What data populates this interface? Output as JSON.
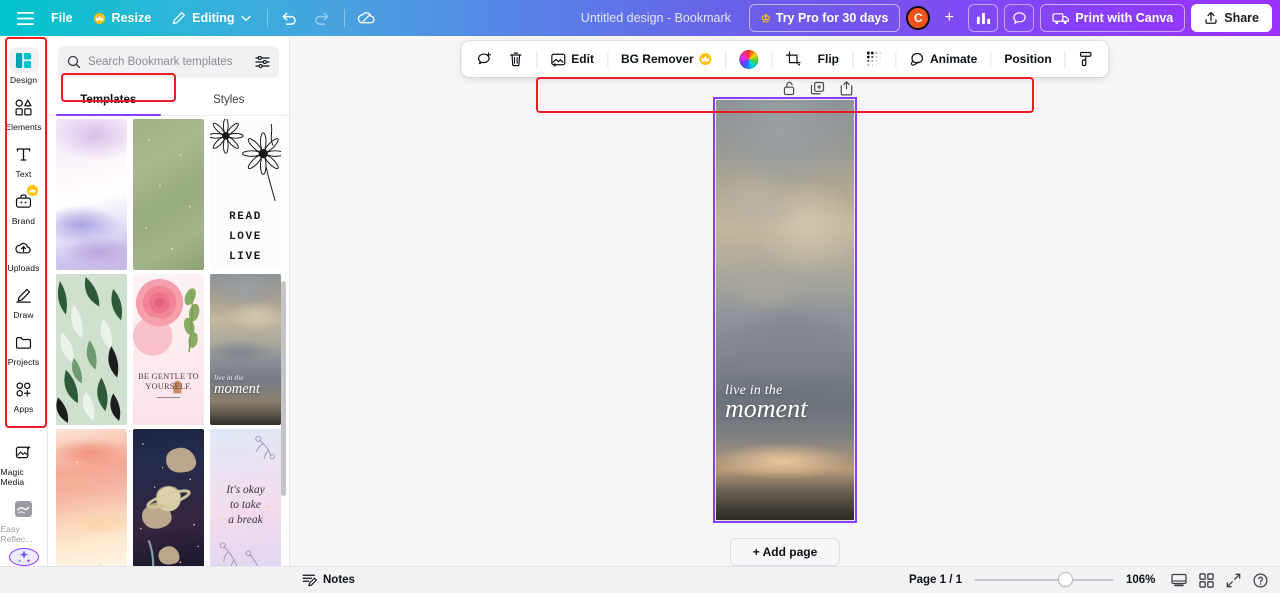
{
  "topbar": {
    "menu_icon": "hamburger-icon",
    "file_label": "File",
    "resize_label": "Resize",
    "editing_label": "Editing",
    "undo_icon": "undo-icon",
    "redo_icon": "redo-icon",
    "cloud_icon": "cloud-sync-icon",
    "doc_title": "Untitled design - Bookmark",
    "try_pro_label": "Try Pro for 30 days",
    "avatar_initial": "C",
    "add_member_label": "+",
    "insights_icon": "insights-bar-chart-icon",
    "comment_icon": "comment-bubble-icon",
    "print_label": "Print with Canva",
    "share_label": "Share"
  },
  "rail": {
    "items": [
      {
        "label": "Design",
        "icon": "design-icon",
        "active": true,
        "badge": ""
      },
      {
        "label": "Elements",
        "icon": "elements-shapes-icon",
        "active": false,
        "badge": ""
      },
      {
        "label": "Text",
        "icon": "text-t-icon",
        "active": false,
        "badge": ""
      },
      {
        "label": "Brand",
        "icon": "brand-briefcase-icon",
        "active": false,
        "badge": "crown"
      },
      {
        "label": "Uploads",
        "icon": "uploads-cloud-icon",
        "active": false,
        "badge": ""
      },
      {
        "label": "Draw",
        "icon": "draw-pen-icon",
        "active": false,
        "badge": ""
      },
      {
        "label": "Projects",
        "icon": "projects-folder-icon",
        "active": false,
        "badge": ""
      },
      {
        "label": "Apps",
        "icon": "apps-grid-icon",
        "active": false,
        "badge": ""
      },
      {
        "label": "Magic Media",
        "icon": "magic-media-icon",
        "active": false,
        "badge": ""
      },
      {
        "label": "Easy Reflec...",
        "icon": "easy-reflections-icon",
        "active": false,
        "badge": ""
      }
    ],
    "magic_button_icon": "magic-sparkle-icon"
  },
  "panel": {
    "search_placeholder": "Search Bookmark templates",
    "search_value": "",
    "search_icon": "search-icon",
    "filter_icon": "filter-sliders-icon",
    "tabs": [
      {
        "label": "Templates",
        "active": true
      },
      {
        "label": "Styles",
        "active": false
      }
    ],
    "templates": [
      {
        "name": "purple-watercolor-bookmark",
        "text": ""
      },
      {
        "name": "green-speckled-bookmark",
        "text": ""
      },
      {
        "name": "daisy-read-love-live-bookmark",
        "text": "READ\nLOVE\nLIVE"
      },
      {
        "name": "green-ferns-bookmark",
        "text": ""
      },
      {
        "name": "pink-rose-be-gentle-bookmark",
        "text": "BE GENTLE TO YOURSELF."
      },
      {
        "name": "clouds-live-in-the-moment-bookmark",
        "text": "live in the moment"
      },
      {
        "name": "peach-watercolor-bookmark",
        "text": ""
      },
      {
        "name": "space-saturn-bookmark",
        "text": ""
      },
      {
        "name": "pastel-its-okay-to-take-a-break-bookmark",
        "text": "It's okay to take a break"
      }
    ]
  },
  "element_toolbar": {
    "items": [
      {
        "name": "comment-add-button",
        "label": "",
        "icon": "comment-plus-icon"
      },
      {
        "name": "delete-button",
        "label": "",
        "icon": "trash-icon"
      },
      {
        "name": "edit-image-button",
        "label": "Edit",
        "icon": "edit-image-icon"
      },
      {
        "name": "bg-remover-button",
        "label": "BG Remover",
        "icon": "crown-icon"
      },
      {
        "name": "color-button",
        "label": "",
        "icon": "color-wheel-icon"
      },
      {
        "name": "crop-button",
        "label": "",
        "icon": "crop-icon"
      },
      {
        "name": "flip-button",
        "label": "Flip",
        "icon": ""
      },
      {
        "name": "transparency-button",
        "label": "",
        "icon": "transparency-checker-icon"
      },
      {
        "name": "animate-button",
        "label": "Animate",
        "icon": "animate-icon"
      },
      {
        "name": "position-button",
        "label": "Position",
        "icon": ""
      },
      {
        "name": "more-options-button",
        "label": "",
        "icon": "paint-roller-icon"
      }
    ]
  },
  "page_tools": {
    "lock_icon": "unlock-icon",
    "duplicate_icon": "duplicate-page-icon",
    "add_page_icon": "add-page-icon"
  },
  "canvas": {
    "design_quote_line1": "live in the",
    "design_quote_line2": "moment",
    "add_page_label": "+ Add page"
  },
  "bottombar": {
    "notes_label": "Notes",
    "notes_icon": "notes-icon",
    "page_count": "Page 1 / 1",
    "zoom_value": "106%",
    "zoom_percent": 61,
    "grid_view_icon": "page-view-icon",
    "thumbnails_icon": "grid-thumbnails-icon",
    "fullscreen_icon": "fullscreen-expand-icon",
    "help_icon": "help-question-icon"
  },
  "colors": {
    "brand_purple": "#8B3DFF",
    "brand_teal": "#00C4CC",
    "highlight_red": "#EE1B24",
    "avatar_orange": "#F2531B",
    "crown_gold": "#FFC107"
  }
}
